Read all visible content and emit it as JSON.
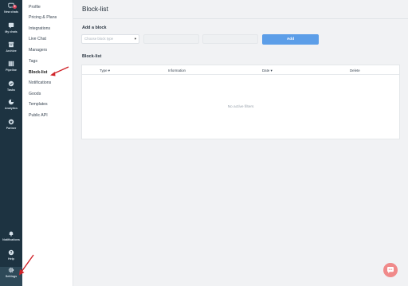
{
  "rail": {
    "items": [
      {
        "label": "New chats",
        "icon": "chat-bubble-icon",
        "badge": "9"
      },
      {
        "label": "My chats",
        "icon": "chats-icon"
      },
      {
        "label": "Archive",
        "icon": "archive-icon"
      },
      {
        "label": "Pipeline",
        "icon": "pipeline-icon"
      },
      {
        "label": "Tasks",
        "icon": "tasks-icon"
      },
      {
        "label": "Analytics",
        "icon": "analytics-icon"
      },
      {
        "label": "Partner",
        "icon": "partner-icon"
      }
    ],
    "bottom": [
      {
        "label": "Notifications",
        "icon": "bell-icon"
      },
      {
        "label": "Help",
        "icon": "help-icon"
      },
      {
        "label": "Settings",
        "icon": "gear-icon"
      }
    ]
  },
  "settings_nav": {
    "items": [
      "Profile",
      "Pricing & Plans",
      "Integrations",
      "Live Chat",
      "Managers",
      "Tags",
      "Block-list",
      "Notifications",
      "Goods",
      "Templates",
      "Public API"
    ],
    "selected": "Block-list"
  },
  "page": {
    "title": "Block-list",
    "add_section": "Add a block",
    "select_placeholder": "Choose block type",
    "add_button": "Add",
    "list_section": "Block-list",
    "columns": [
      "Type ▾",
      "Information",
      "Date ▾",
      "Delete"
    ],
    "empty_text": "No active filters"
  },
  "colors": {
    "rail_bg": "#1d3341",
    "accent": "#5c9ee8",
    "arrow": "#d0242a",
    "chat_fab": "#f08a8a"
  }
}
